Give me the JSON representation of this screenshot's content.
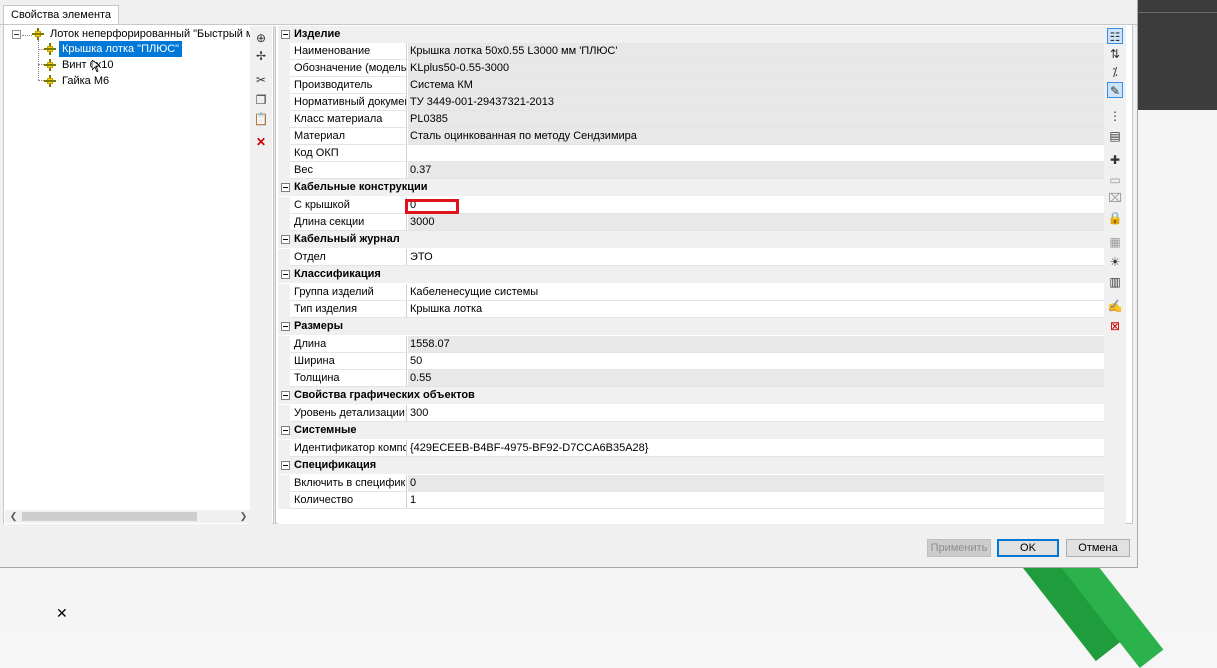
{
  "tab": {
    "label": "Свойства элемента"
  },
  "tree": {
    "root": {
      "label": "Лоток неперфорированный \"Быстрый мон"
    },
    "children": [
      {
        "label": "Крышка лотка \"ПЛЮС\"",
        "selected": true
      },
      {
        "label": "Винт 6х10"
      },
      {
        "label": "Гайка М6"
      }
    ]
  },
  "categories": {
    "c1": "Изделие",
    "c2": "Кабельные конструкции",
    "c3": "Кабельный журнал",
    "c4": "Классификация",
    "c5": "Размеры",
    "c6": "Свойства графических объектов",
    "c7": "Системные",
    "c8": "Спецификация"
  },
  "props": {
    "p1": {
      "name": "Наименование",
      "value": "Крышка лотка 50x0.55 L3000 мм 'ПЛЮС'"
    },
    "p2": {
      "name": "Обозначение (модель)",
      "value": "KLplus50-0.55-3000"
    },
    "p3": {
      "name": "Производитель",
      "value": "Система КМ"
    },
    "p4": {
      "name": "Нормативный документ",
      "value": "ТУ 3449-001-29437321-2013"
    },
    "p5": {
      "name": "Класс материала",
      "value": "PL0385"
    },
    "p6": {
      "name": "Материал",
      "value": "Сталь оцинкованная по методу Сендзимира"
    },
    "p7": {
      "name": "Код ОКП",
      "value": ""
    },
    "p8": {
      "name": "Вес",
      "value": "0.37"
    },
    "p9": {
      "name": "С крышкой",
      "value": "0"
    },
    "p10": {
      "name": "Длина секции",
      "value": "3000"
    },
    "p11": {
      "name": "Отдел",
      "value": "ЭТО"
    },
    "p12": {
      "name": "Группа изделий",
      "value": "Кабеленесущие системы"
    },
    "p13": {
      "name": "Тип изделия",
      "value": "Крышка лотка"
    },
    "p14": {
      "name": "Длина",
      "value": "1558.07"
    },
    "p15": {
      "name": "Ширина",
      "value": "50"
    },
    "p16": {
      "name": "Толщина",
      "value": "0.55"
    },
    "p17": {
      "name": "Уровень детализации",
      "value": "300"
    },
    "p18": {
      "name": "Идентификатор компон...",
      "value": "{429ECEEB-B4BF-4975-BF92-D7CCA6B35A28}"
    },
    "p19": {
      "name": "Включить в специфика...",
      "value": "0"
    },
    "p20": {
      "name": "Количество",
      "value": "1"
    }
  },
  "buttons": {
    "apply": "Применить",
    "ok": "OK",
    "cancel": "Отмена"
  },
  "colors": {
    "selection": "#0078d7",
    "highlight_box": "#e0131c",
    "stripe": "#1f9d3c"
  }
}
